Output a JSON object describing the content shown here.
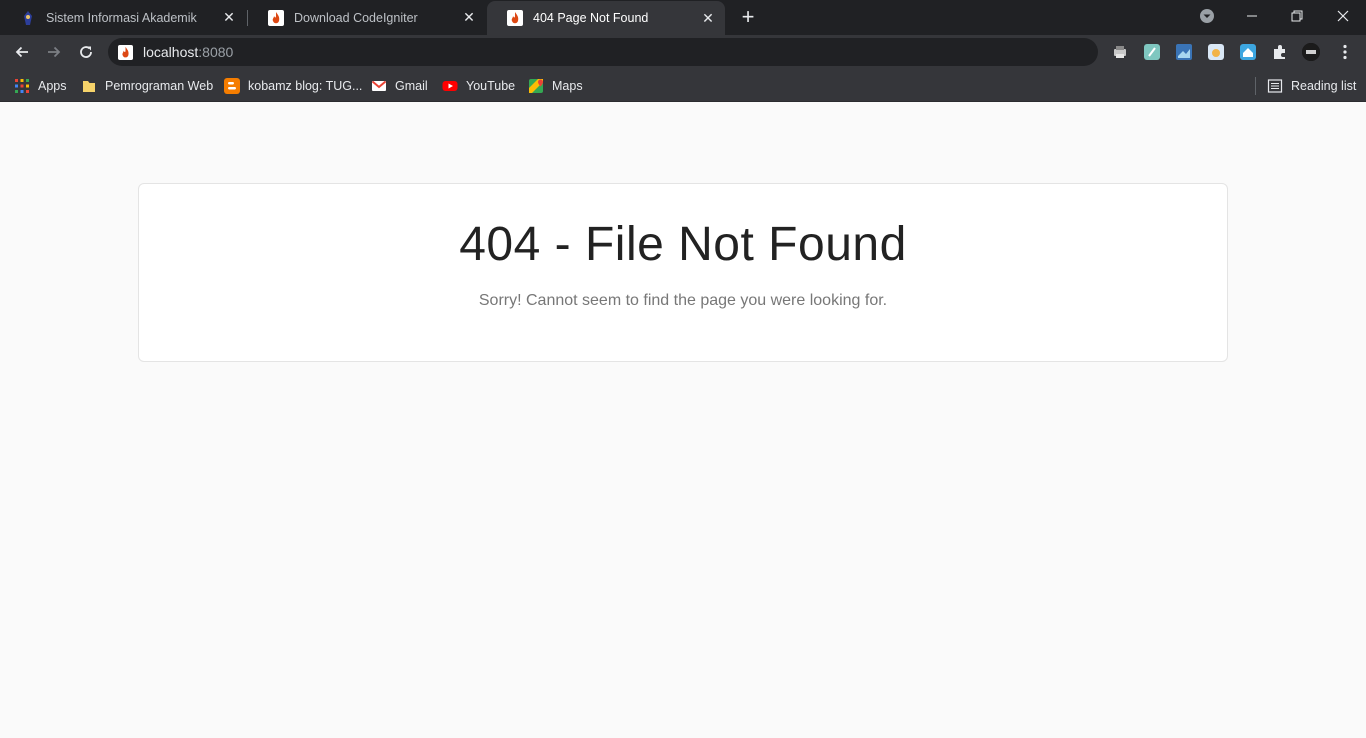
{
  "tabs": [
    {
      "title": "Sistem Informasi Akademik",
      "icon": "university-logo-icon",
      "active": false
    },
    {
      "title": "Download CodeIgniter",
      "icon": "codeigniter-flame-icon",
      "active": false
    },
    {
      "title": "404 Page Not Found",
      "icon": "codeigniter-flame-icon",
      "active": true
    }
  ],
  "new_tab_label": "+",
  "omnibox": {
    "host": "localhost",
    "port": ":8080"
  },
  "bookmarks": [
    {
      "label": "Apps",
      "icon": "apps-grid-icon"
    },
    {
      "label": "Pemrograman Web",
      "icon": "folder-icon"
    },
    {
      "label": "kobamz blog: TUG...",
      "icon": "blogger-icon"
    },
    {
      "label": "Gmail",
      "icon": "gmail-icon"
    },
    {
      "label": "YouTube",
      "icon": "youtube-icon"
    },
    {
      "label": "Maps",
      "icon": "maps-icon"
    }
  ],
  "reading_list": "Reading list",
  "content": {
    "heading": "404 - File Not Found",
    "message": "Sorry! Cannot seem to find the page you were looking for."
  },
  "colors": {
    "tabstrip": "#202124",
    "toolbar": "#35363a",
    "page_bg": "#fafafa",
    "heading": "#222222",
    "message": "#777777"
  }
}
